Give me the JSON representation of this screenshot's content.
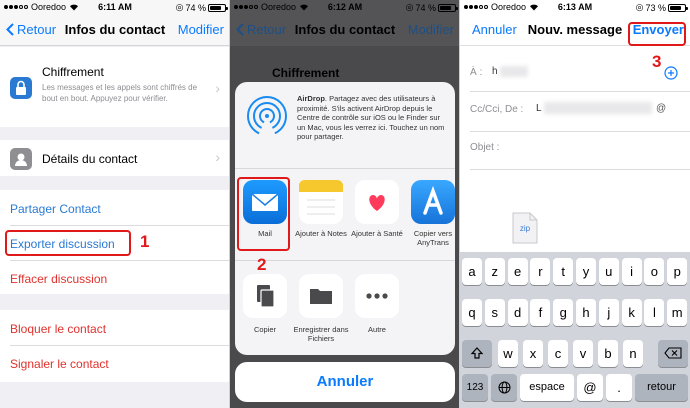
{
  "panel1": {
    "status": {
      "carrier": "Ooredoo",
      "time": "6:11 AM",
      "battery": "74 %",
      "battery_level": 0.74
    },
    "nav": {
      "back": "Retour",
      "title": "Infos du contact",
      "action": "Modifier"
    },
    "encryption": {
      "title": "Chiffrement",
      "description": "Les messages et les appels sont chiffrés de bout en bout. Appuyez pour vérifier."
    },
    "contact_details": "Détails du contact",
    "share_contact": "Partager Contact",
    "export_chat": "Exporter discussion",
    "clear_chat": "Effacer discussion",
    "block_contact": "Bloquer le contact",
    "report_contact": "Signaler le contact",
    "step": "1"
  },
  "panel2": {
    "status": {
      "carrier": "Ooredoo",
      "time": "6:12 AM",
      "battery": "74 %",
      "battery_level": 0.74
    },
    "nav": {
      "back": "Retour",
      "title": "Infos du contact",
      "action": "Modifier"
    },
    "bg_title": "Chiffrement",
    "airdrop": {
      "title": "AirDrop",
      "text": ". Partagez avec des utilisateurs à proximité. S'ils activent AirDrop depuis le Centre de contrôle sur iOS ou le Finder sur un Mac, vous les verrez ici. Touchez un nom pour partager."
    },
    "apps": [
      {
        "label": "Mail"
      },
      {
        "label": "Ajouter à Notes"
      },
      {
        "label": "Ajouter à Santé"
      },
      {
        "label": "Copier vers AnyTrans"
      }
    ],
    "actions": [
      {
        "label": "Copier"
      },
      {
        "label": "Enregistrer dans Fichiers"
      },
      {
        "label": "Autre"
      }
    ],
    "cancel": "Annuler",
    "step": "2"
  },
  "panel3": {
    "status": {
      "carrier": "Ooredoo",
      "time": "6:13 AM",
      "battery": "73 %",
      "battery_level": 0.73
    },
    "nav": {
      "cancel": "Annuler",
      "title": "Nouv. message",
      "send": "Envoyer"
    },
    "to_label": "À :",
    "to_value": "h",
    "cc_label": "Cc/Cci, De :",
    "cc_value": "L",
    "subject_label": "Objet :",
    "attachment": "zip",
    "step": "3",
    "keyboard": {
      "row1": [
        "a",
        "z",
        "e",
        "r",
        "t",
        "y",
        "u",
        "i",
        "o",
        "p"
      ],
      "row2": [
        "q",
        "s",
        "d",
        "f",
        "g",
        "h",
        "j",
        "k",
        "l",
        "m"
      ],
      "row3": [
        "w",
        "x",
        "c",
        "v",
        "b",
        "n"
      ],
      "numbers": "123",
      "space": "espace",
      "at": "@",
      "dot": ".",
      "return": "retour"
    }
  }
}
